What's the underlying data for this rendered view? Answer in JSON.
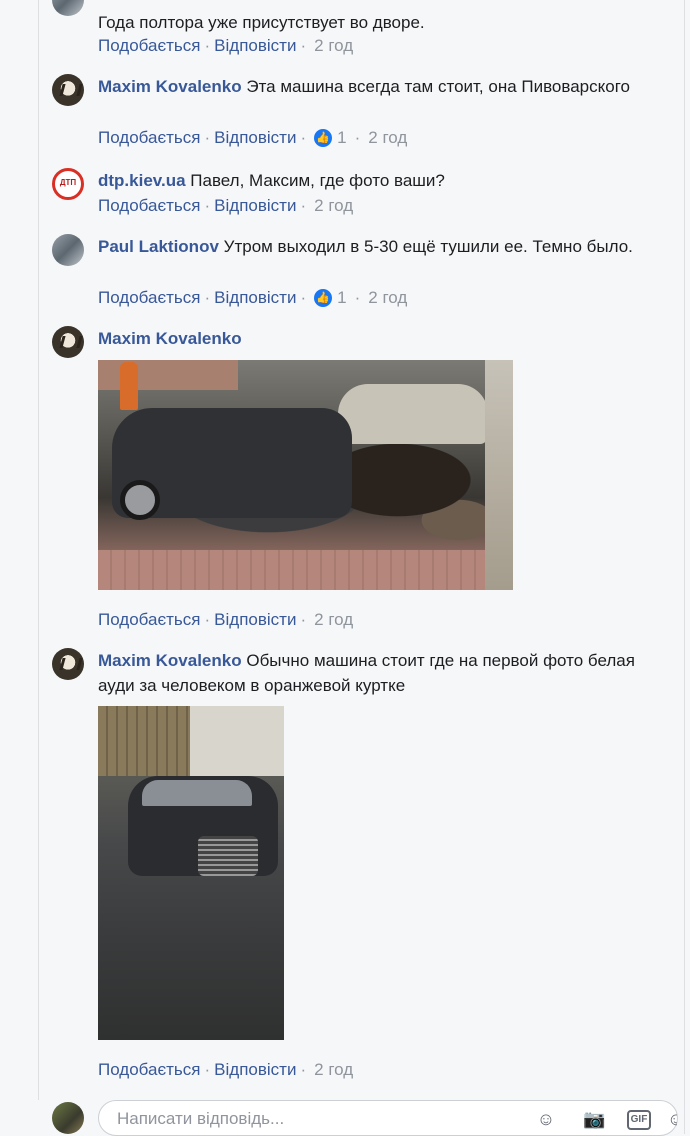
{
  "actions": {
    "like": "Подобається",
    "reply": "Відповісти",
    "separator": "·"
  },
  "comments": [
    {
      "name": "",
      "text": "Года полтора уже присутствует во дворе.",
      "time": "2 год",
      "likes": ""
    },
    {
      "name": "Maxim Kovalenko",
      "text": "Эта машина всегда там стоит, она Пивоварского",
      "time": "2 год",
      "likes": "1"
    },
    {
      "name": "dtp.kiev.ua",
      "text": "Павел, Максим, где фото ваши?",
      "time": "2 год",
      "likes": ""
    },
    {
      "name": "Paul Laktionov",
      "text": "Утром выходил в 5-30 ещё тушили ее. Темно было.",
      "time": "2 год",
      "likes": "1"
    },
    {
      "name": "Maxim Kovalenko",
      "text": "",
      "time": "2 год",
      "likes": ""
    },
    {
      "name": "Maxim Kovalenko",
      "text": "Обычно машина стоит где на первой фото белая ауди за человеком в оранжевой куртке",
      "time": "2 год",
      "likes": ""
    }
  ],
  "dtp_avatar_text": "ДТП",
  "composer": {
    "placeholder": "Написати відповідь..."
  },
  "icons": {
    "like": "thumbs-up-icon",
    "emoji": "emoji-icon",
    "camera": "camera-icon",
    "gif": "gif-icon",
    "sticker": "sticker-icon"
  },
  "colors": {
    "link": "#385898",
    "meta": "#90949c",
    "like_badge": "#1877f2",
    "background": "#f6f7f9"
  }
}
